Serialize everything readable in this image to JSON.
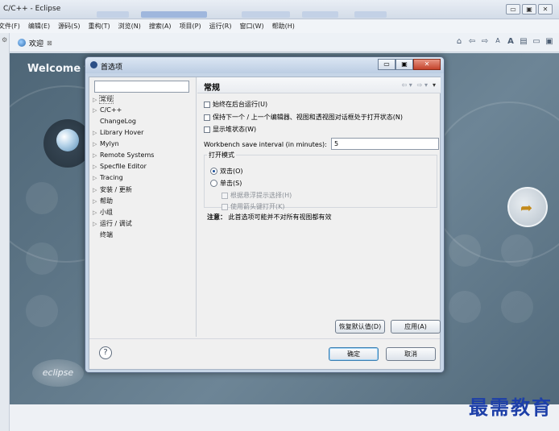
{
  "window": {
    "title": "C/C++ - Eclipse",
    "buttons": [
      "▭",
      "▣",
      "✕"
    ]
  },
  "menubar": [
    "文件(F)",
    "编辑(E)",
    "源码(S)",
    "重构(T)",
    "浏览(N)",
    "搜索(A)",
    "项目(P)",
    "运行(R)",
    "窗口(W)",
    "帮助(H)"
  ],
  "toolbar": {
    "tab_label": "欢迎",
    "tab_close": "⊠"
  },
  "welcome": {
    "heading": "Welcome to Eclipse IDE for C/C++ Developers",
    "logo_text": "eclipse"
  },
  "dialog": {
    "title": "首选项",
    "filter_value": "",
    "tree": [
      {
        "label": "常规",
        "expander": "▷",
        "selected": true
      },
      {
        "label": "C/C++",
        "expander": "▷"
      },
      {
        "label": "ChangeLog",
        "expander": ""
      },
      {
        "label": "Library Hover",
        "expander": "▷"
      },
      {
        "label": "Mylyn",
        "expander": "▷"
      },
      {
        "label": "Remote Systems",
        "expander": "▷"
      },
      {
        "label": "Specfile Editor",
        "expander": "▷"
      },
      {
        "label": "Tracing",
        "expander": "▷"
      },
      {
        "label": "安装 / 更新",
        "expander": "▷"
      },
      {
        "label": "帮助",
        "expander": "▷"
      },
      {
        "label": "小组",
        "expander": "▷"
      },
      {
        "label": "运行 / 调试",
        "expander": "▷"
      },
      {
        "label": "终端",
        "expander": ""
      }
    ],
    "pane": {
      "title": "常规",
      "options": [
        "始终在后台运行(U)",
        "保持下一个 / 上一个编辑器、视图和透视图对话框处于打开状态(N)",
        "显示堆状态(W)"
      ],
      "interval_label": "Workbench save interval (in minutes):",
      "interval_value": "5",
      "open_mode": {
        "group_title": "打开模式",
        "double_click": "双击(O)",
        "single_click": "单击(S)",
        "select_on_hover": "根据悬浮提示选择(H)",
        "open_with_arrow": "使用箭头键打开(K)"
      },
      "note_label": "注意：",
      "note_text": "此首选项可能并不对所有视图都有效",
      "restore_defaults": "恢复默认值(D)",
      "apply": "应用(A)"
    },
    "ok": "确定",
    "cancel": "取消",
    "help": "?"
  },
  "watermark": "最需教育"
}
